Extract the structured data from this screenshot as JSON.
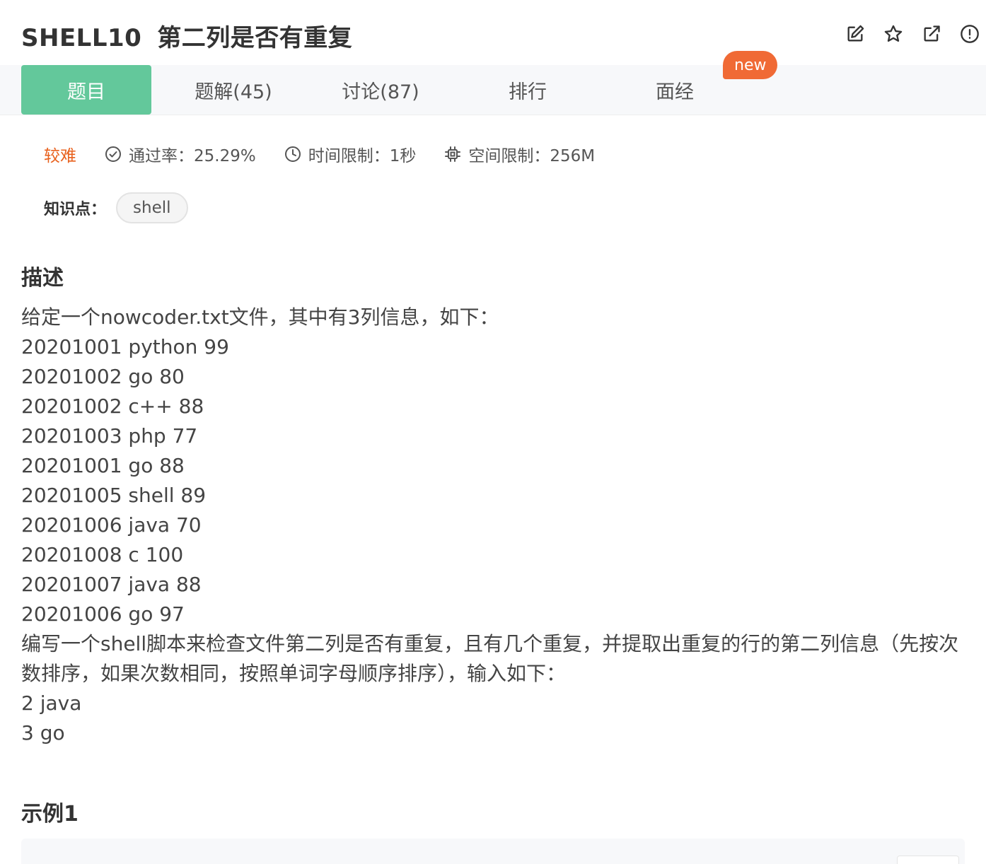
{
  "header": {
    "code": "SHELL10",
    "title": "第二列是否有重复",
    "actions": [
      {
        "name": "edit-icon"
      },
      {
        "name": "star-icon"
      },
      {
        "name": "share-icon"
      },
      {
        "name": "report-icon"
      }
    ]
  },
  "tabs": [
    {
      "label": "题目",
      "active": true
    },
    {
      "label": "题解(45)"
    },
    {
      "label": "讨论(87)"
    },
    {
      "label": "排行"
    },
    {
      "label": "面经"
    }
  ],
  "tab_badge": "new",
  "meta": {
    "difficulty": "较难",
    "pass_rate": "通过率：25.29%",
    "time_limit": "时间限制：1秒",
    "memory_limit": "空间限制：256M"
  },
  "knowledge": {
    "label": "知识点：",
    "tags": [
      "shell"
    ]
  },
  "description": {
    "title": "描述",
    "lines": [
      "给定一个nowcoder.txt文件，其中有3列信息，如下：",
      "20201001 python 99",
      "20201002 go 80",
      "20201002 c++ 88",
      "20201003 php 77",
      "20201001 go 88",
      "20201005 shell 89",
      "20201006 java 70",
      "20201008 c 100",
      "20201007 java 88",
      "20201006 go 97",
      "编写一个shell脚本来检查文件第二列是否有重复，且有几个重复，并提取出重复的行的第二列信息（先按次数排序，如果次数相同，按照单词字母顺序排序），输入如下：",
      "2 java",
      "3 go"
    ]
  },
  "example": {
    "title": "示例1"
  },
  "colors": {
    "accent": "#63c89b",
    "difficulty": "#e8601c",
    "badge": "#f06a35"
  }
}
